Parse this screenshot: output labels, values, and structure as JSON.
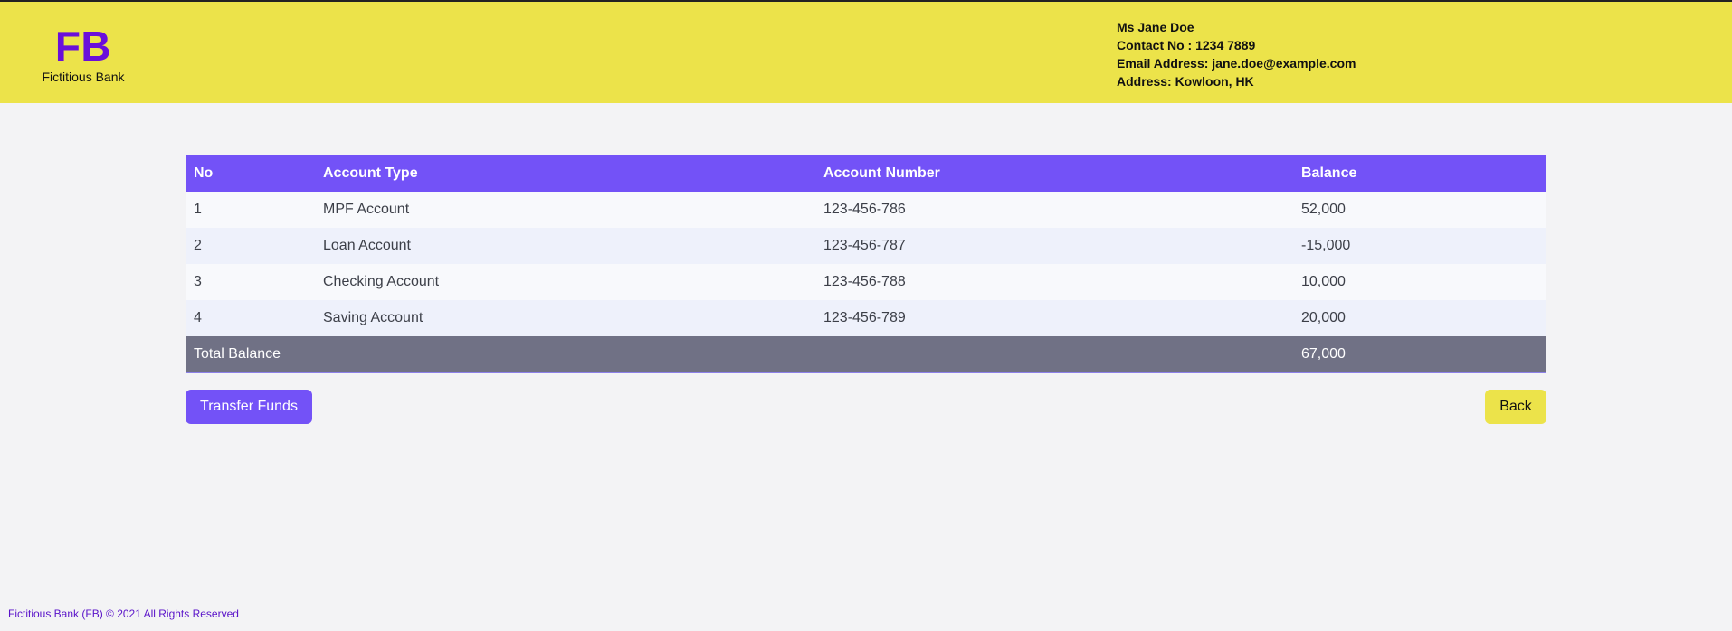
{
  "header": {
    "logo_mark": "FB",
    "logo_name": "Fictitious Bank",
    "profile": {
      "name": "Ms Jane Doe",
      "contact": "Contact No : 1234 7889",
      "email": "Email Address: jane.doe@example.com",
      "address": "Address: Kowloon, HK"
    }
  },
  "table": {
    "headers": [
      "No",
      "Account Type",
      "Account Number",
      "Balance"
    ],
    "rows": [
      {
        "no": "1",
        "type": "MPF Account",
        "number": "123-456-786",
        "balance": "52,000"
      },
      {
        "no": "2",
        "type": "Loan Account",
        "number": "123-456-787",
        "balance": "-15,000"
      },
      {
        "no": "3",
        "type": "Checking Account",
        "number": "123-456-788",
        "balance": "10,000"
      },
      {
        "no": "4",
        "type": "Saving Account",
        "number": "123-456-789",
        "balance": "20,000"
      }
    ],
    "total": {
      "label": "Total Balance",
      "balance": "67,000"
    }
  },
  "actions": {
    "transfer_label": "Transfer Funds",
    "back_label": "Back"
  },
  "footer": {
    "text": "Fictitious Bank (FB) © 2021 All Rights Reserved"
  },
  "colors": {
    "header_bg": "#ece34a",
    "accent_purple": "#7352f7",
    "logo_purple": "#6a0fd9",
    "total_row_bg": "#707185"
  }
}
